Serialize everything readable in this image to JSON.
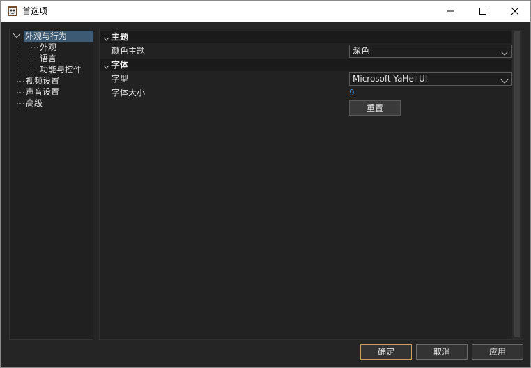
{
  "window": {
    "title": "首选项",
    "app_icon": "app-icon",
    "controls": [
      "minimize-icon",
      "maximize-icon",
      "close-icon"
    ]
  },
  "tree": {
    "items": [
      {
        "label": "外观与行为",
        "expanded": true,
        "selected": true
      },
      {
        "label": "外观"
      },
      {
        "label": "语言"
      },
      {
        "label": "功能与控件"
      },
      {
        "label": "视频设置"
      },
      {
        "label": "声音设置"
      },
      {
        "label": "高级"
      }
    ]
  },
  "sections": {
    "theme": {
      "header": "主题",
      "color_theme_label": "颜色主题",
      "color_theme_value": "深色"
    },
    "font": {
      "header": "字体",
      "typeface_label": "字型",
      "typeface_value": "Microsoft YaHei UI",
      "size_label": "字体大小",
      "size_value": "9",
      "reset_label": "重置"
    }
  },
  "buttons": {
    "ok": "确定",
    "cancel": "取消",
    "apply": "应用"
  },
  "colors": {
    "selection": "#3c5a73",
    "link": "#3d8fd8",
    "primary_border": "#c8a062"
  }
}
